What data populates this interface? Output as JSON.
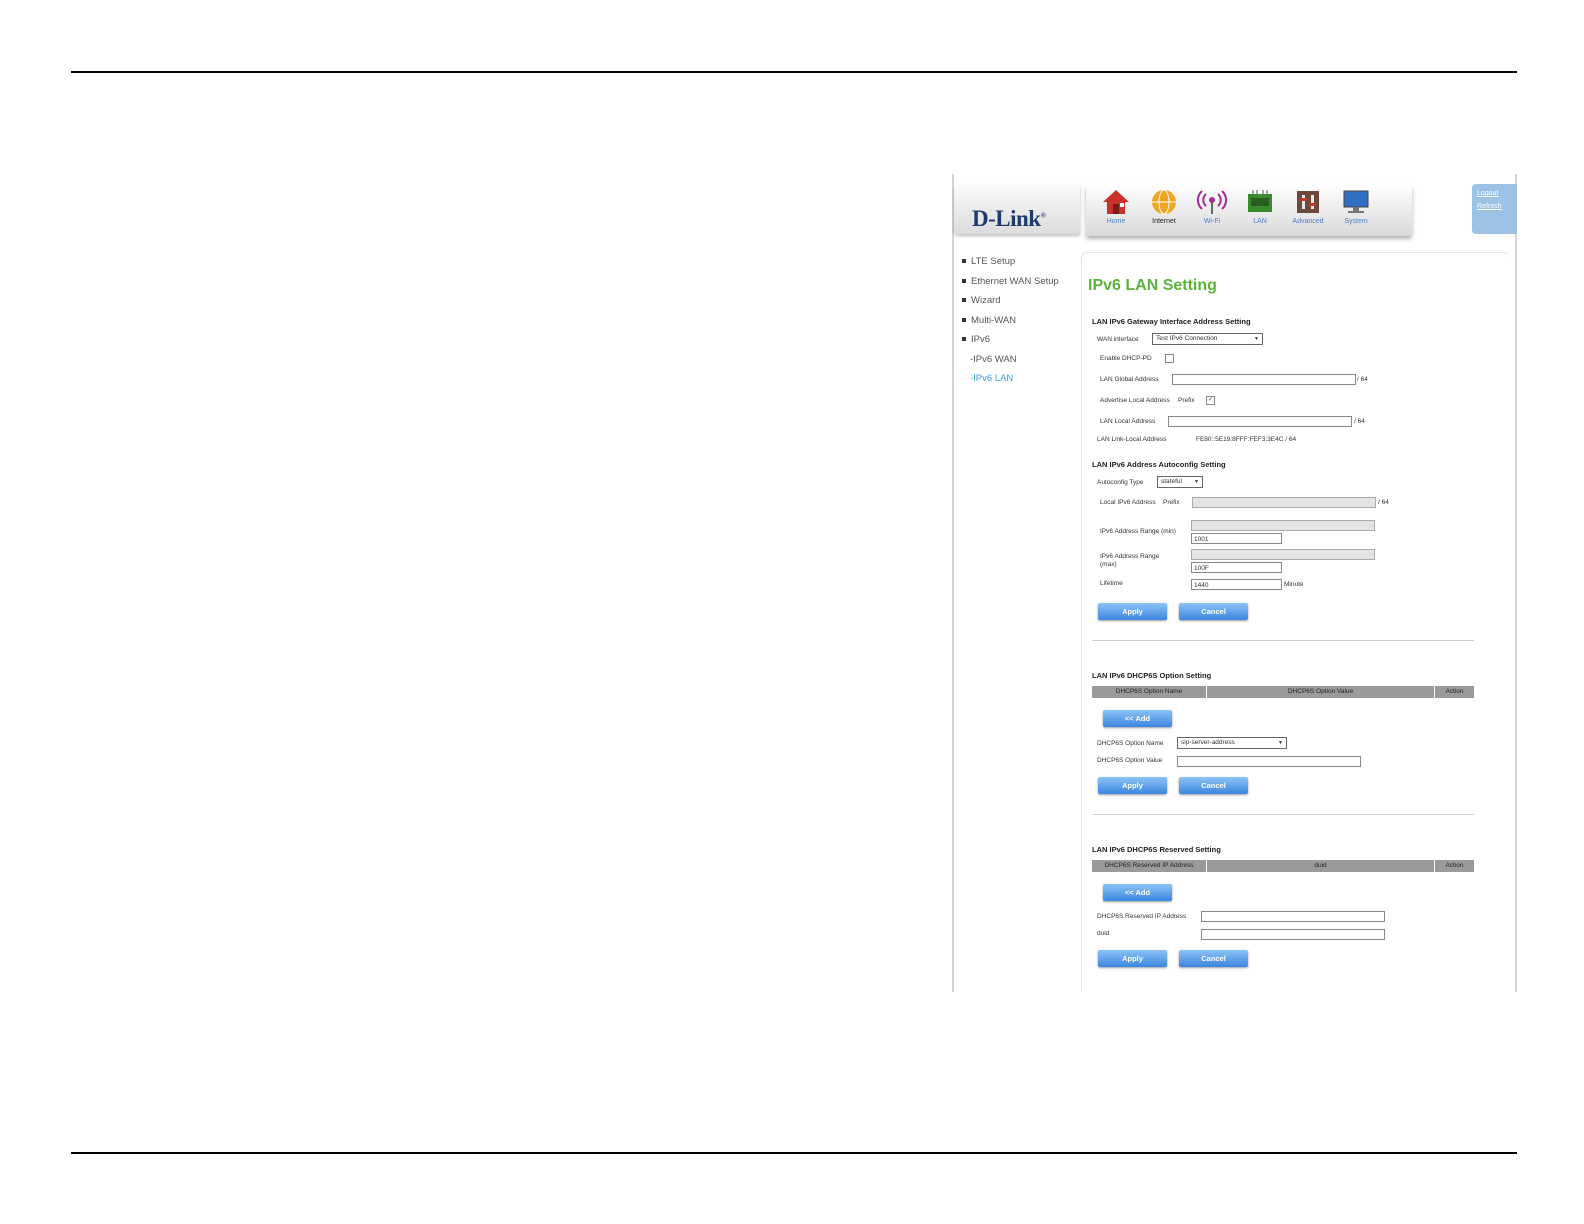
{
  "header": {
    "logo": "D-Link",
    "nav": [
      {
        "label": "Home",
        "icon": "home-icon"
      },
      {
        "label": "Internet",
        "icon": "globe-icon"
      },
      {
        "label": "Wi-Fi",
        "icon": "wifi-icon"
      },
      {
        "label": "LAN",
        "icon": "lan-icon"
      },
      {
        "label": "Advanced",
        "icon": "advanced-icon"
      },
      {
        "label": "System",
        "icon": "monitor-icon"
      }
    ],
    "logout": "Logout",
    "refresh": "Refresh"
  },
  "sidebar": {
    "items": [
      "LTE Setup",
      "Ethernet WAN Setup",
      "Wizard",
      "Multi-WAN",
      "IPv6"
    ],
    "subitems": [
      "-IPv6 WAN",
      "-IPv6 LAN"
    ]
  },
  "main": {
    "title": "IPv6 LAN Setting",
    "gateway": {
      "title": "LAN IPv6 Gateway Interface Address Setting",
      "wan_interface_label": "WAN interface",
      "wan_interface_value": "Test IPv6 Connection",
      "enable_dhcp_pd_label": "Enable DHCP-PD",
      "global_address_label": "LAN Global Address",
      "suffix_64": "/ 64",
      "advertise_label": "Advertise Local Address",
      "prefix_label": "Prefix",
      "advertise_checked_glyph": "✓",
      "local_address_label": "LAN Local Address",
      "link_local_label": "LAN Link-Local Address",
      "link_local_value": "FE80::5E19:8FFF:FEF3:3E4C / 64"
    },
    "autoconfig": {
      "title": "LAN IPv6 Address Autoconfig Setting",
      "type_label": "Autoconfig Type",
      "type_value": "stateful",
      "local_address_label": "Local IPv6 Address",
      "prefix_label": "Prefix",
      "suffix_64": "/ 64",
      "range_min_label": "IPv6 Address Range (min)",
      "range_min_value": "1001",
      "range_max_label_1": "IPv6 Address Range",
      "range_max_label_2": "(max)",
      "range_max_value": "100F",
      "lifetime_label": "Lifetime",
      "lifetime_value": "1440",
      "lifetime_unit": "Minute"
    },
    "dhcp6s_option": {
      "title": "LAN IPv6 DHCP6S Option Setting",
      "columns": [
        "DHCP6S Option Name",
        "DHCP6S Option Value",
        "Action"
      ],
      "add_label": "<< Add",
      "name_label": "DHCP6S Option Name",
      "name_value": "sip-server-address",
      "value_label": "DHCP6S Option Value"
    },
    "dhcp6s_reserved": {
      "title": "LAN IPv6 DHCP6S Reserved Setting",
      "columns": [
        "DHCP6S Reserved IP Address",
        "duid",
        "Action"
      ],
      "add_label": "<< Add",
      "ip_label": "DHCP6S Reserved IP Address",
      "duid_label": "duid"
    },
    "apply_label": "Apply",
    "cancel_label": "Cancel",
    "select_arrow": "▼"
  }
}
